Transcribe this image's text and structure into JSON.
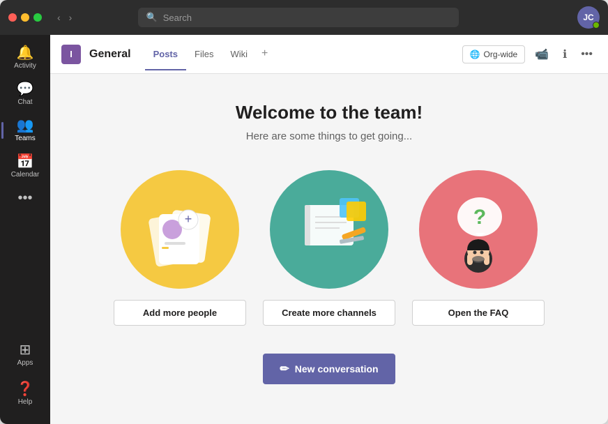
{
  "titlebar": {
    "search_placeholder": "Search"
  },
  "avatar": {
    "initials": "JC",
    "status_color": "#6bb700"
  },
  "sidebar": {
    "items": [
      {
        "id": "activity",
        "label": "Activity",
        "icon": "🔔",
        "active": false
      },
      {
        "id": "chat",
        "label": "Chat",
        "icon": "💬",
        "active": false
      },
      {
        "id": "teams",
        "label": "Teams",
        "icon": "👥",
        "active": true
      },
      {
        "id": "calendar",
        "label": "Calendar",
        "icon": "📅",
        "active": false
      }
    ],
    "bottom_items": [
      {
        "id": "apps",
        "label": "Apps",
        "icon": "⊞"
      },
      {
        "id": "help",
        "label": "Help",
        "icon": "❓"
      }
    ],
    "more_icon": "•••"
  },
  "channel": {
    "avatar_letter": "I",
    "name": "General",
    "tabs": [
      {
        "id": "posts",
        "label": "Posts",
        "active": true
      },
      {
        "id": "files",
        "label": "Files",
        "active": false
      },
      {
        "id": "wiki",
        "label": "Wiki",
        "active": false
      }
    ],
    "org_wide_label": "Org-wide",
    "actions": {
      "video_icon": "📹",
      "info_icon": "ℹ",
      "more_icon": "•••"
    }
  },
  "posts": {
    "welcome_title": "Welcome to the team!",
    "welcome_subtitle": "Here are some things to get going...",
    "cards": [
      {
        "id": "add-people",
        "button_label": "Add more people",
        "color": "yellow"
      },
      {
        "id": "create-channels",
        "button_label": "Create more channels",
        "color": "teal"
      },
      {
        "id": "open-faq",
        "button_label": "Open the FAQ",
        "color": "pink"
      }
    ],
    "new_conversation_label": "New conversation"
  }
}
